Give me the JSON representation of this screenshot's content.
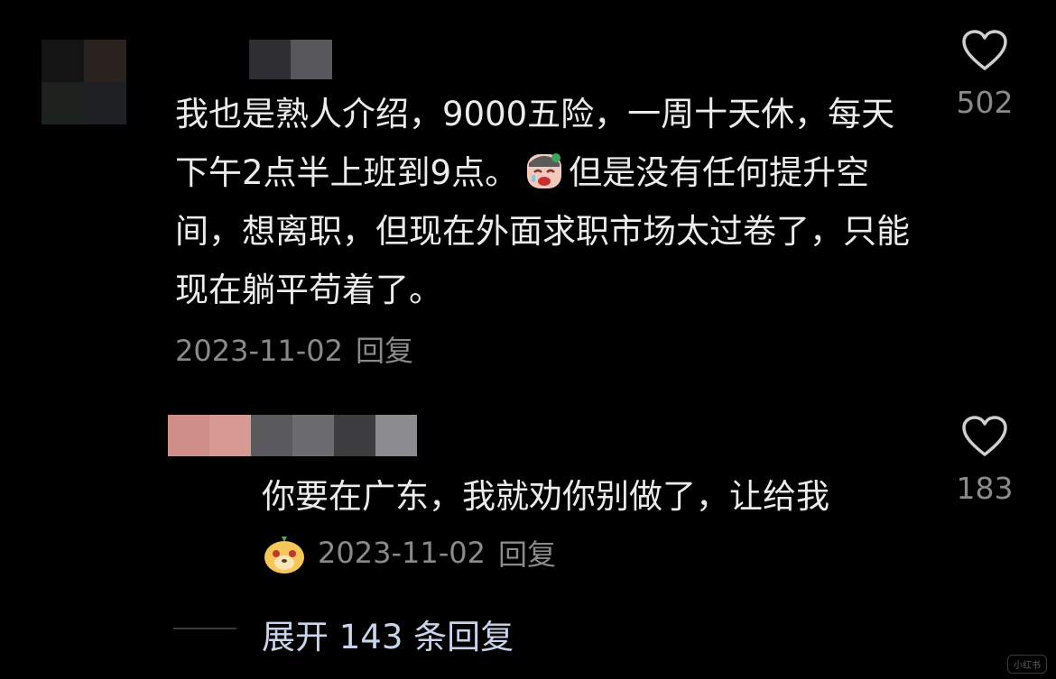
{
  "comment": {
    "text_part1": "我也是熟人介绍，9000五险，一周十天休，每天下午2点半上班到9点。",
    "text_part2": "但是没有任何提升空间，想离职，但现在外面求职市场太过卷了，只能现在躺平苟着了。",
    "inline_emoji": "crying-face-emoji",
    "date": "2023-11-02",
    "reply_label": "回复",
    "like_count": "502"
  },
  "reply": {
    "text": "你要在广东，我就劝你别做了，让给我",
    "emoji": "cheeky-dog-face-emoji",
    "date": "2023-11-02",
    "reply_label": "回复",
    "like_count": "183"
  },
  "expand": {
    "label": "展开 143 条回复"
  },
  "watermark": "小红书",
  "colors": {
    "background": "#000000",
    "text": "#ececec",
    "meta": "#8a8a8a",
    "expand_link": "#c9d4ec"
  }
}
